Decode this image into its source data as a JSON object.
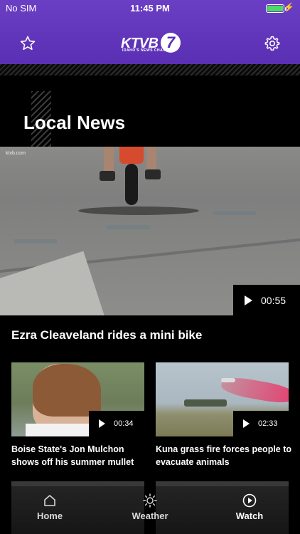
{
  "status_bar": {
    "carrier": "No SIM",
    "time": "11:45 PM",
    "battery_percent": 100
  },
  "header": {
    "logo_main": "KTVB",
    "logo_number": "7",
    "logo_sub": "IDAHO'S NEWS CHANNEL",
    "left_icon": "star-icon",
    "right_icon": "gear-icon",
    "brand_color": "#5b2fb3"
  },
  "section": {
    "title": "Local News"
  },
  "hero": {
    "watermark": "ktvb.com",
    "duration": "00:55",
    "title": "Ezra Cleaveland rides a mini bike"
  },
  "stories": [
    {
      "duration": "00:34",
      "title": "Boise State's Jon Mulchon shows off his summer mullet"
    },
    {
      "duration": "02:33",
      "title": "Kuna grass fire forces people to evacuate animals"
    }
  ],
  "tabbar": {
    "tabs": [
      {
        "label": "Home",
        "icon": "home-icon"
      },
      {
        "label": "Weather",
        "icon": "sun-icon"
      },
      {
        "label": "Watch",
        "icon": "play-circle-icon"
      }
    ],
    "active": "Watch"
  }
}
